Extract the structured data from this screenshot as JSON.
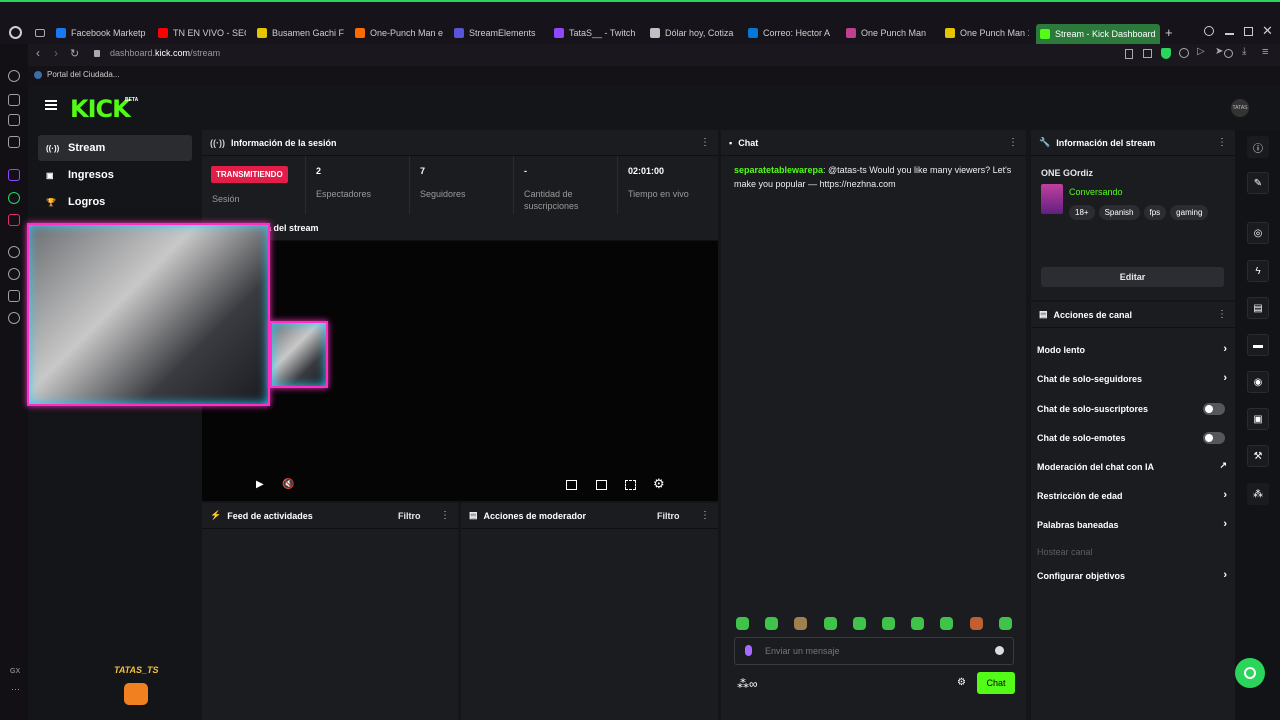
{
  "browser": {
    "tabs": [
      {
        "label": "Facebook Marketp",
        "color": "#1877f2"
      },
      {
        "label": "TN EN VIVO - SEG",
        "color": "#ff0000"
      },
      {
        "label": "Busamen Gachi F",
        "color": "#e6c400"
      },
      {
        "label": "One-Punch Man e",
        "color": "#ff6a00"
      },
      {
        "label": "StreamElements",
        "color": "#5856d6"
      },
      {
        "label": "TataS__ - Twitch",
        "color": "#9146ff"
      },
      {
        "label": "Dólar hoy, Cotiza",
        "color": "#c0c0c0"
      },
      {
        "label": "Correo: Hector A",
        "color": "#0078d4"
      },
      {
        "label": "One Punch Man",
        "color": "#c04090"
      },
      {
        "label": "One Punch Man 1",
        "color": "#e6c400"
      },
      {
        "label": "Stream - Kick Dashboard",
        "color": "#53fc18"
      }
    ],
    "url_prefix": "dashboard.",
    "url_domain": "kick.com",
    "url_path": "/stream",
    "bookmark": "Portal del Ciudada...",
    "gx_label": "GX"
  },
  "kick": {
    "logo": "KICK",
    "beta": "BETA",
    "avatar": "TATAS",
    "nav": [
      {
        "label": "Stream"
      },
      {
        "label": "Ingresos"
      },
      {
        "label": "Logros"
      }
    ]
  },
  "session": {
    "title": "Información de la sesión",
    "live_badge": "TRANSMITIENDO",
    "session_label": "Sesión",
    "stats": [
      {
        "value": "2",
        "label": "Espectadores"
      },
      {
        "value": "7",
        "label": "Seguidores"
      },
      {
        "value": "-",
        "label": "Cantidad de suscripciones"
      },
      {
        "value": "02:01:00",
        "label": "Tiempo en vivo"
      }
    ]
  },
  "preview": {
    "title": "a del stream"
  },
  "feed": {
    "title": "Feed de actividades",
    "filter": "Filtro"
  },
  "modactions": {
    "title": "Acciones de moderador",
    "filter": "Filtro"
  },
  "chat": {
    "title": "Chat",
    "messages": [
      {
        "user": "separatetablewarepa",
        "text": ": @tatas-ts Would you like many viewers? Let's make you popular — https://nezhna.com"
      }
    ],
    "placeholder": "Enviar un mensaje",
    "send_label": "Chat"
  },
  "stream_info": {
    "title": "Información del stream",
    "stream_title": "ONE GOrdiz",
    "category": "Conversando",
    "tags": [
      "18+",
      "Spanish",
      "fps",
      "gaming"
    ],
    "edit_label": "Editar"
  },
  "channel_actions": {
    "title": "Acciones de canal",
    "items": [
      {
        "label": "Modo lento",
        "control": "chevron"
      },
      {
        "label": "Chat de solo-seguidores",
        "control": "chevron"
      },
      {
        "label": "Chat de solo-suscriptores",
        "control": "toggle"
      },
      {
        "label": "Chat de solo-emotes",
        "control": "toggle"
      },
      {
        "label": "Moderación del chat con IA",
        "control": "external"
      },
      {
        "label": "Restricción de edad",
        "control": "chevron"
      },
      {
        "label": "Palabras baneadas",
        "control": "chevron"
      },
      {
        "label": "Hostear canal",
        "control": "none"
      },
      {
        "label": "Configurar objetivos",
        "control": "chevron"
      }
    ]
  },
  "overlay": {
    "streamer_tag": "TATAS_TS"
  },
  "colors": {
    "accent": "#53fc18",
    "live": "#e11d48",
    "panel": "#1b1c20"
  }
}
